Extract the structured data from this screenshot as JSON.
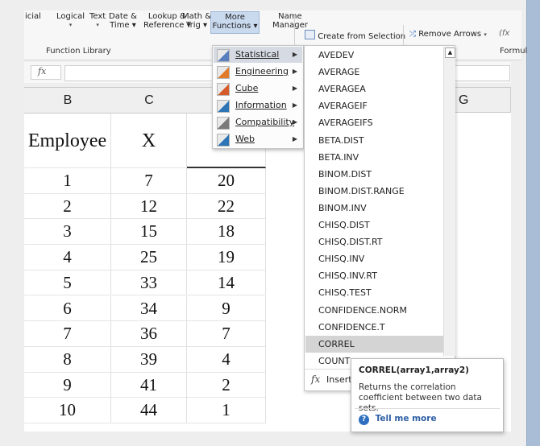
{
  "ribbon": {
    "buttons": [
      {
        "name": "financial-button",
        "l1": "icial",
        "l2": ""
      },
      {
        "name": "logical-button",
        "l1": "Logical",
        "l2": "▾"
      },
      {
        "name": "text-button",
        "l1": "Text",
        "l2": "▾"
      },
      {
        "name": "date-time-button",
        "l1": "Date &",
        "l2": "Time ▾"
      },
      {
        "name": "lookup-reference-button",
        "l1": "Lookup &",
        "l2": "Reference ▾"
      },
      {
        "name": "math-trig-button",
        "l1": "Math &",
        "l2": "Trig ▾"
      },
      {
        "name": "more-functions-button",
        "l1": "More",
        "l2": "Functions ▾"
      },
      {
        "name": "name-manager-button",
        "l1": "Name",
        "l2": "Manager"
      }
    ],
    "create_from_selection": "Create from Selection",
    "remove_arrows": "Remove Arrows",
    "function_library_label": "Function Library",
    "formula_label": "Formul"
  },
  "formula_bar": {
    "fx": "fx"
  },
  "columns": [
    "B",
    "C",
    "",
    "",
    "G"
  ],
  "headers": {
    "b": "Employee",
    "c": "X"
  },
  "rows": [
    {
      "b": "1",
      "c": "7",
      "d": "20"
    },
    {
      "b": "2",
      "c": "12",
      "d": "22"
    },
    {
      "b": "3",
      "c": "15",
      "d": "18"
    },
    {
      "b": "4",
      "c": "25",
      "d": "19"
    },
    {
      "b": "5",
      "c": "33",
      "d": "14"
    },
    {
      "b": "6",
      "c": "34",
      "d": "9"
    },
    {
      "b": "7",
      "c": "36",
      "d": "7"
    },
    {
      "b": "8",
      "c": "39",
      "d": "4"
    },
    {
      "b": "9",
      "c": "41",
      "d": "2"
    },
    {
      "b": "10",
      "c": "44",
      "d": "1"
    }
  ],
  "more_functions_menu": [
    {
      "label": "Statistical",
      "icon": "statistical-icon",
      "color": "#5a7fbf"
    },
    {
      "label": "Engineering",
      "icon": "engineering-icon",
      "color": "#e07b2a"
    },
    {
      "label": "Cube",
      "icon": "cube-icon",
      "color": "#d65b2a"
    },
    {
      "label": "Information",
      "icon": "information-icon",
      "color": "#2e75b6"
    },
    {
      "label": "Compatibility",
      "icon": "compatibility-icon",
      "color": "#7a7a7a"
    },
    {
      "label": "Web",
      "icon": "web-icon",
      "color": "#2e75b6"
    }
  ],
  "statistical_functions": [
    "AVEDEV",
    "AVERAGE",
    "AVERAGEA",
    "AVERAGEIF",
    "AVERAGEIFS",
    "BETA.DIST",
    "BETA.INV",
    "BINOM.DIST",
    "BINOM.DIST.RANGE",
    "BINOM.INV",
    "CHISQ.DIST",
    "CHISQ.DIST.RT",
    "CHISQ.INV",
    "CHISQ.INV.RT",
    "CHISQ.TEST",
    "CONFIDENCE.NORM",
    "CONFIDENCE.T",
    "CORREL",
    "COUNT"
  ],
  "selected_function": "CORREL",
  "insert_function": {
    "fx": "fx",
    "label": "Insert"
  },
  "tooltip": {
    "signature": "CORREL(array1,array2)",
    "description": "Returns the correlation coefficient between two data sets.",
    "link": "Tell me more"
  }
}
